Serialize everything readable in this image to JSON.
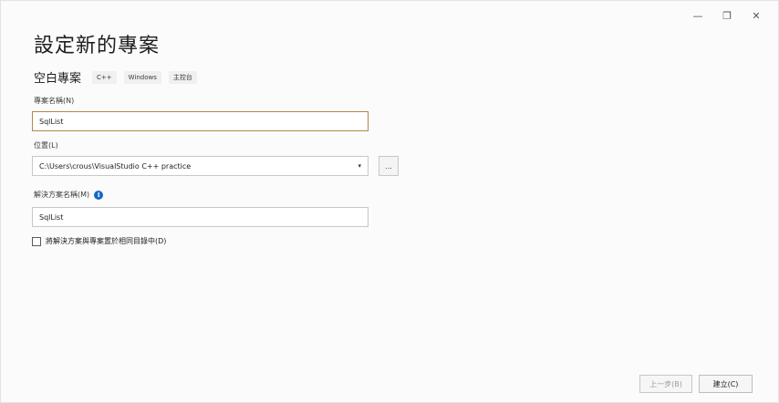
{
  "window": {
    "minimize_glyph": "—",
    "restore_glyph": "❐",
    "close_glyph": "✕"
  },
  "page": {
    "title": "設定新的專案"
  },
  "template": {
    "name": "空白專案",
    "tags": [
      "C++",
      "Windows",
      "主控台"
    ]
  },
  "project_name": {
    "label": "專案名稱(N)",
    "value": "SqlList"
  },
  "location": {
    "label": "位置(L)",
    "value": "C:\\Users\\crous\\VisualStudio C++ practice",
    "browse_label": "..."
  },
  "solution_name": {
    "label": "解決方案名稱(M)",
    "value": "SqlList"
  },
  "same_directory": {
    "label": "將解決方案與專案置於相同目錄中(D)",
    "checked": false
  },
  "footer": {
    "back_label": "上一步(B)",
    "create_label": "建立(C)"
  },
  "icons": {
    "info": "info-icon",
    "dropdown": "chevron-down-icon"
  },
  "colors": {
    "focus_border": "#b0894a",
    "info_blue": "#1668c7"
  }
}
